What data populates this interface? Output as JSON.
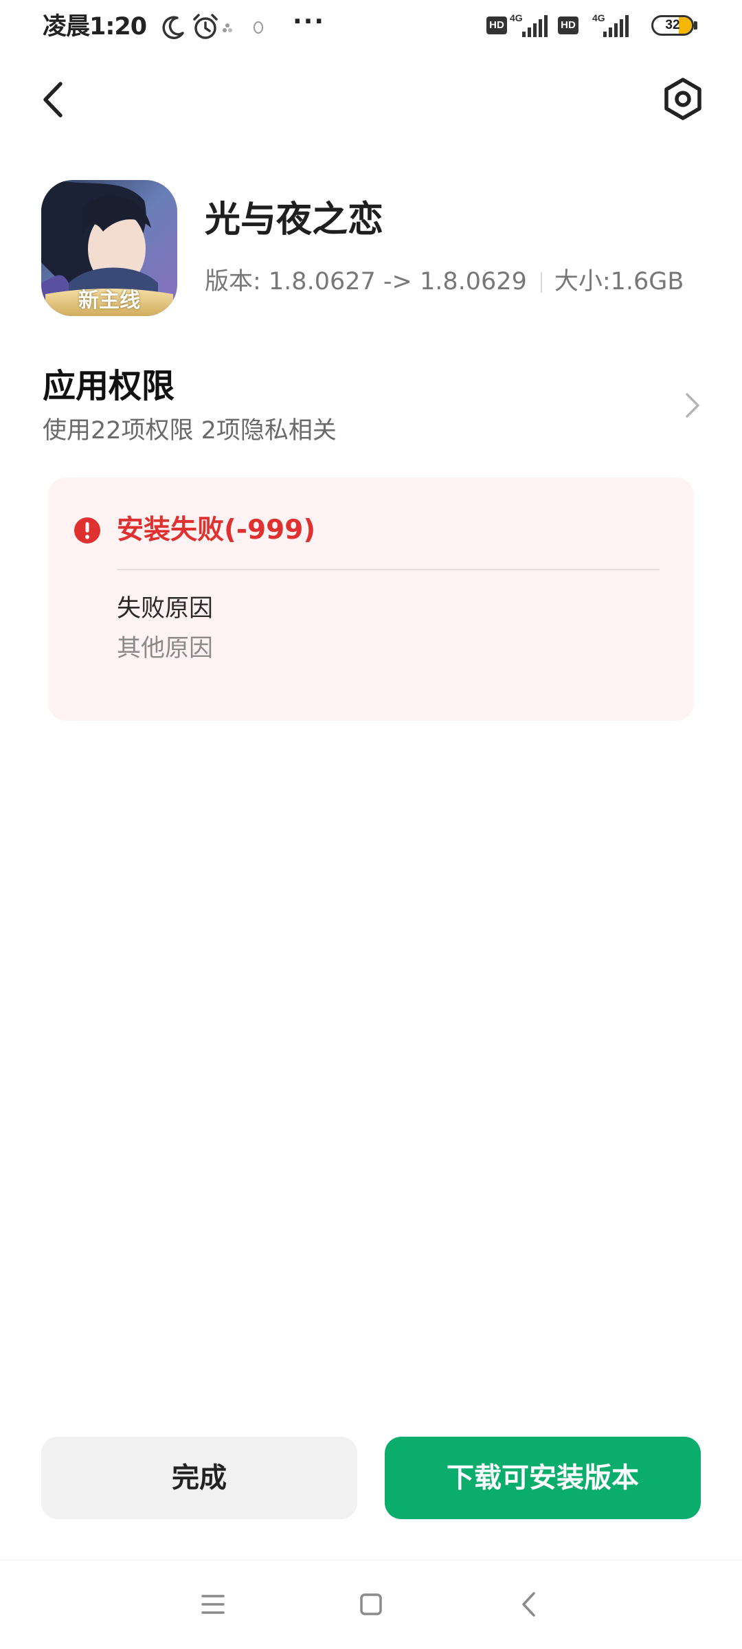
{
  "status_bar": {
    "time": "凌晨1:20",
    "more": "···",
    "hd1": "HD",
    "net1": "4G",
    "hd2": "HD",
    "net2": "4G",
    "battery": "32",
    "battery_level_percent": 32,
    "icons": [
      "moon-icon",
      "alarm-icon",
      "notification-icon",
      "qq-icon",
      "signal-icon",
      "battery-icon"
    ]
  },
  "header": {
    "back_icon": "back-arrow-icon",
    "settings_icon": "gear-icon"
  },
  "app": {
    "name": "光与夜之恋",
    "icon_badge": "新主线",
    "version_text": "版本: 1.8.0627 -> 1.8.0629",
    "size_text": "大小:1.6GB"
  },
  "permissions": {
    "title": "应用权限",
    "summary": "使用22项权限 2项隐私相关"
  },
  "error": {
    "title": "安装失败(-999)",
    "reason_label": "失败原因",
    "reason_value": "其他原因",
    "accent_color": "#e03131"
  },
  "actions": {
    "done_label": "完成",
    "download_label": "下载可安装版本",
    "primary_color": "#0aad6c"
  },
  "nav_bar": {
    "icons": [
      "menu-icon",
      "home-icon",
      "back-icon"
    ]
  }
}
